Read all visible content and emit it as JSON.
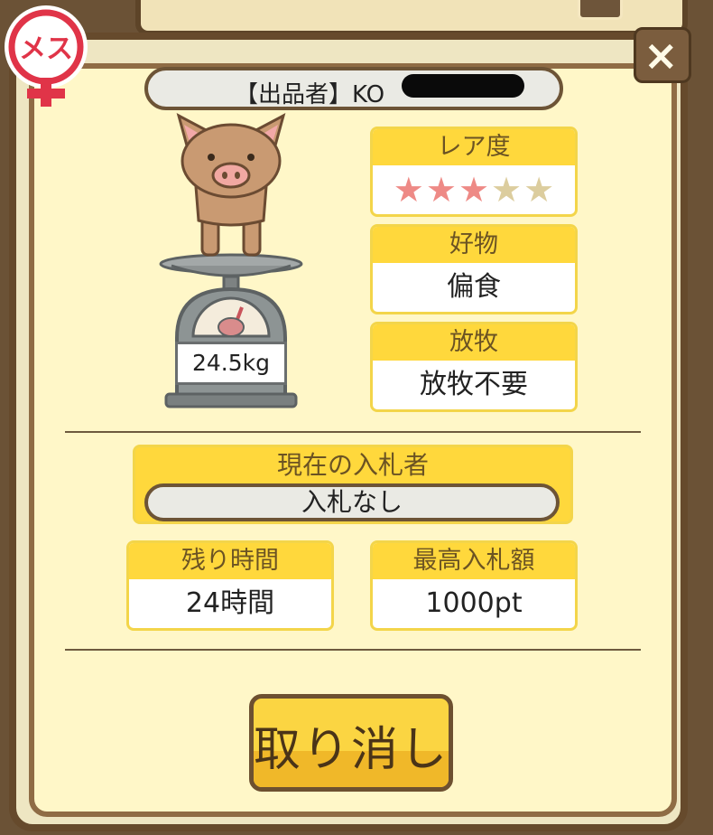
{
  "dialog": {
    "gender_label": "メス",
    "close_label": "×",
    "seller_text": "【出品者】KO",
    "weight": "24.5kg",
    "rarity": {
      "label": "レア度",
      "stars_filled": 3,
      "stars_total": 5
    },
    "favorite": {
      "label": "好物",
      "value": "偏食"
    },
    "grazing": {
      "label": "放牧",
      "value": "放牧不要"
    },
    "current_bidder": {
      "label": "現在の入札者",
      "value": "入札なし"
    },
    "remaining_time": {
      "label": "残り時間",
      "value": "24時間"
    },
    "highest_bid": {
      "label": "最高入札額",
      "value": "1000pt"
    },
    "cancel_label": "取り消し"
  },
  "colors": {
    "accent_yellow": "#ffd83c",
    "frame_brown": "#664a2c",
    "panel_cream": "#fff7c8",
    "star_on": "#ee8a86",
    "star_off": "#dccd9e",
    "gender_red": "#e03448"
  }
}
